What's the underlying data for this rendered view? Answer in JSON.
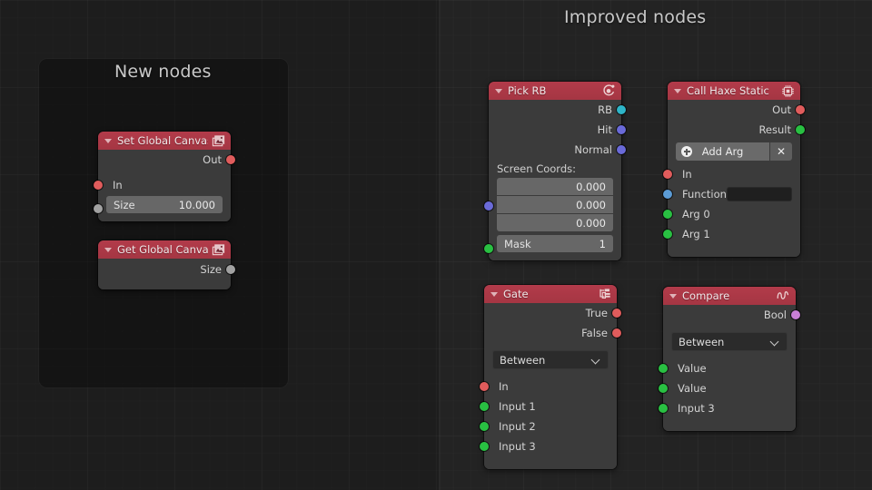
{
  "canvas": {
    "left_caption": "New nodes",
    "right_caption": "Improved nodes"
  },
  "colors": {
    "header_red": "#b23b4a",
    "node_body": "#3b3b3b",
    "socket_red": "#e05c5c",
    "socket_green": "#29c042",
    "socket_grey": "#a1a1a1",
    "socket_cyan": "#2eb5c8",
    "socket_purple": "#6a6ad8",
    "socket_pink": "#c97fd6"
  },
  "nodes": [
    {
      "id": "set-global-canvas",
      "title": "Set Global Canvas ..",
      "icon": "image-icon",
      "outputs": [
        {
          "label": "Out",
          "color": "#e05c5c"
        }
      ],
      "inputs": [
        {
          "label": "In",
          "color": "#e05c5c"
        }
      ],
      "widgets": [
        {
          "type": "value",
          "label": "Size",
          "value": "10.000",
          "socket_color": "#a1a1a1"
        }
      ]
    },
    {
      "id": "get-global-canvas",
      "title": "Get Global Canvas ..",
      "icon": "image-icon",
      "outputs": [
        {
          "label": "Size",
          "color": "#a1a1a1"
        }
      ],
      "inputs": [],
      "widgets": []
    },
    {
      "id": "pick-rb",
      "title": "Pick RB",
      "icon": "physics-icon",
      "outputs": [
        {
          "label": "RB",
          "color": "#2eb5c8"
        },
        {
          "label": "Hit",
          "color": "#6a6ad8"
        },
        {
          "label": "Normal",
          "color": "#6a6ad8"
        }
      ],
      "section_label": "Screen Coords:",
      "vector": {
        "socket_color": "#6a6ad8",
        "values": [
          "0.000",
          "0.000",
          "0.000"
        ]
      },
      "widgets": [
        {
          "type": "value",
          "label": "Mask",
          "value": "1",
          "socket_color": "#29c042"
        }
      ]
    },
    {
      "id": "call-haxe-static",
      "title": "Call Haxe Static",
      "icon": "chip-icon",
      "outputs": [
        {
          "label": "Out",
          "color": "#e05c5c"
        },
        {
          "label": "Result",
          "color": "#29c042"
        }
      ],
      "button": {
        "label": "Add Arg",
        "plus": "plus-icon",
        "close": "✕"
      },
      "inputs": [
        {
          "label": "In",
          "color": "#e05c5c"
        },
        {
          "label": "Function",
          "color": "#5b9bd5",
          "field": ""
        },
        {
          "label": "Arg 0",
          "color": "#29c042"
        },
        {
          "label": "Arg 1",
          "color": "#29c042"
        }
      ]
    },
    {
      "id": "gate",
      "title": "Gate",
      "icon": "nodetree-icon",
      "outputs": [
        {
          "label": "True",
          "color": "#e05c5c"
        },
        {
          "label": "False",
          "color": "#e05c5c"
        }
      ],
      "dropdown": {
        "value": "Between"
      },
      "inputs": [
        {
          "label": "In",
          "color": "#e05c5c"
        },
        {
          "label": "Input 1",
          "color": "#29c042"
        },
        {
          "label": "Input 2",
          "color": "#29c042"
        },
        {
          "label": "Input 3",
          "color": "#29c042"
        }
      ]
    },
    {
      "id": "compare",
      "title": "Compare",
      "icon": "wave-icon",
      "outputs": [
        {
          "label": "Bool",
          "color": "#c97fd6"
        }
      ],
      "dropdown": {
        "value": "Between"
      },
      "inputs": [
        {
          "label": "Value",
          "color": "#29c042"
        },
        {
          "label": "Value",
          "color": "#29c042"
        },
        {
          "label": "Input 3",
          "color": "#29c042"
        }
      ]
    }
  ]
}
